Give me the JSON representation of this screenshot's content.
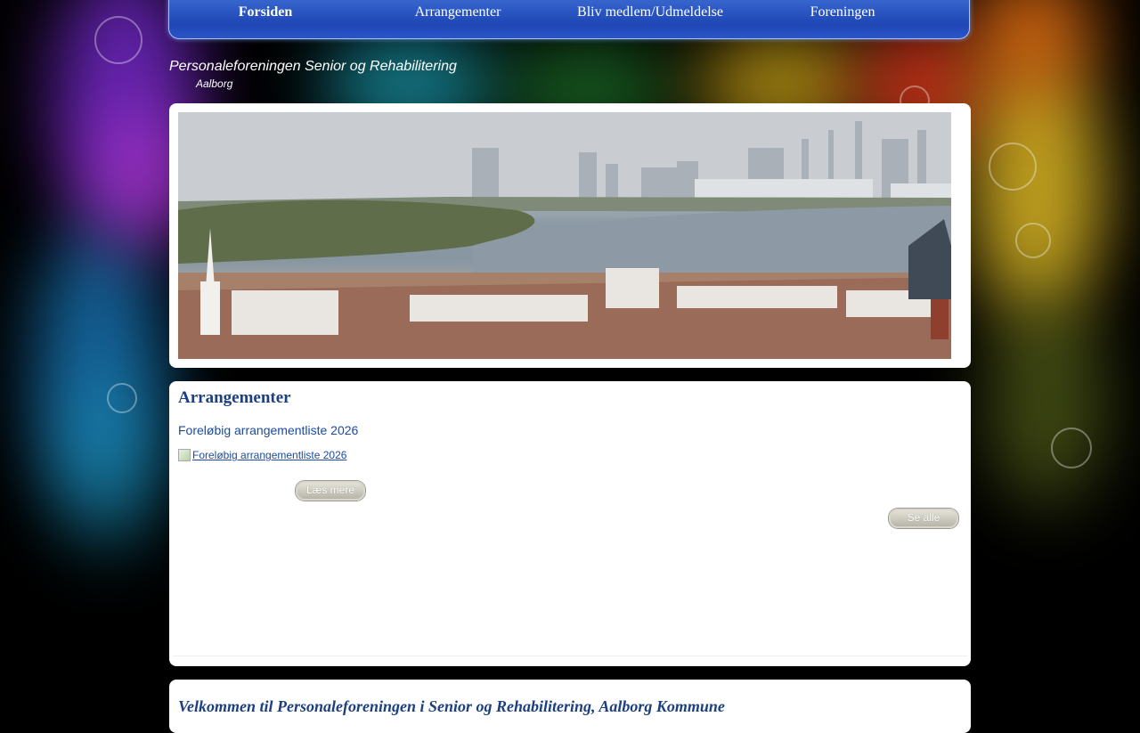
{
  "nav": {
    "items": [
      "Forsiden",
      "Arrangementer",
      "Bliv medlem/Udmeldelse",
      "Foreningen"
    ],
    "active_index": 0
  },
  "site": {
    "title": "Personaleforeningen Senior og Rehabilitering",
    "subtitle": "Aalborg"
  },
  "hero": {
    "image_alt": "Aalborg harbour panorama"
  },
  "events": {
    "heading": "Arrangementer",
    "item_title": "Foreløbig arrangementliste 2026",
    "image_link": "Foreløbig arrangementliste 2026",
    "read_more": "Læs mere",
    "see_all": "Se alle"
  },
  "welcome": {
    "heading": "Velkommen til Personaleforeningen i Senior og Rehabilitering, Aalborg Kommune"
  },
  "colors": {
    "nav": "#1e46b4",
    "heading": "#1b3f80",
    "link": "#1d4ba0"
  }
}
